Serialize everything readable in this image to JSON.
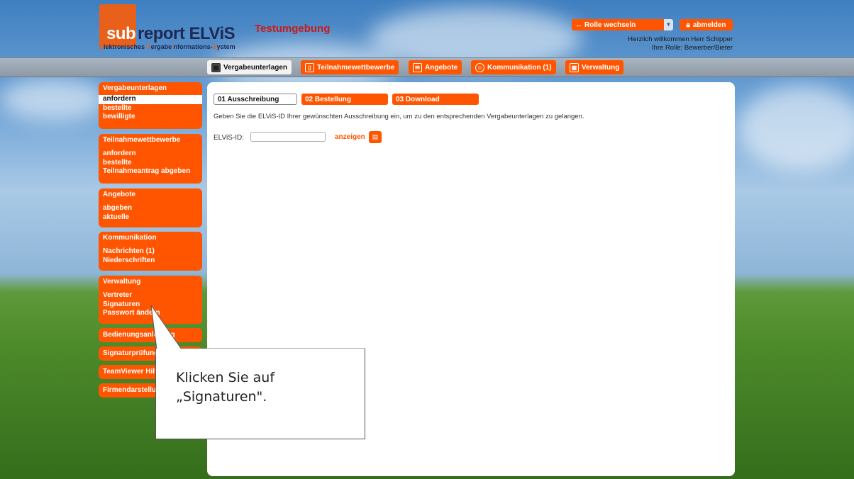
{
  "header": {
    "logo_sub": "sub",
    "logo_report": "report ELViS",
    "logo_tagline_parts": [
      "E",
      "lektronisches ",
      "V",
      "ergabe",
      "i",
      "nformations-",
      "S",
      "ystem"
    ],
    "environment": "Testumgebung",
    "role_switch_label": "Rolle wechseln",
    "logout_label": "abmelden",
    "welcome_line": "Herzlich willkommen Herr Schipper",
    "role_line": "Ihre Rolle: Bewerber/Bieter"
  },
  "nav": [
    {
      "label": "Vergabeunterlagen",
      "icon": "document-icon",
      "active": true
    },
    {
      "label": "Teilnahmewettbewerbe",
      "icon": "form-icon",
      "active": false
    },
    {
      "label": "Angebote",
      "icon": "envelope-icon",
      "active": false
    },
    {
      "label": "Kommunikation (1)",
      "icon": "chat-icon",
      "active": false
    },
    {
      "label": "Verwaltung",
      "icon": "grid-icon",
      "active": false
    }
  ],
  "main": {
    "tabs": [
      {
        "label": "01 Ausschreibung",
        "active": true
      },
      {
        "label": "02 Bestellung",
        "active": false
      },
      {
        "label": "03 Download",
        "active": false
      }
    ],
    "info_text": "Geben Sie die ELViS-ID Ihrer gewünschten Ausschreibung ein, um zu den entsprechenden Vergabeunterlagen zu gelangen.",
    "id_label": "ELViS-ID:",
    "id_value": "",
    "show_label": "anzeigen"
  },
  "sidebar": {
    "groups": [
      {
        "title": "Vergabeunterlagen",
        "items": [
          "anfordern",
          "bestellte",
          "bewilligte"
        ],
        "selected": 0
      },
      {
        "title": "Teilnahmewettbewerbe",
        "items": [
          "anfordern",
          "bestellte",
          "Teilnahmeantrag abgeben"
        ]
      },
      {
        "title": "Angebote",
        "items": [
          "abgeben",
          "aktuelle"
        ]
      },
      {
        "title": "Kommunikation",
        "items": [
          "Nachrichten (1)",
          "Niederschriften"
        ]
      },
      {
        "title": "Verwaltung",
        "items": [
          "Vertreter",
          "Signaturen",
          "Passwort ändern"
        ]
      }
    ],
    "singles": [
      "Bedienungsanleitung",
      "Signaturprüfung",
      "TeamViewer Hilfe",
      "Firmendarstellung"
    ]
  },
  "callout": {
    "line1": "Klicken Sie auf",
    "line2": "„Signaturen\"."
  },
  "colors": {
    "accent": "#ff5500",
    "brand_navy": "#1e2a55",
    "environment_red": "#cc1a1a"
  }
}
